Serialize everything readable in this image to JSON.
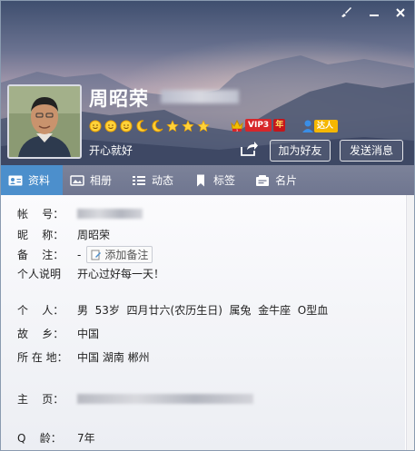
{
  "header": {
    "name": "周昭荣",
    "signature": "开心就好",
    "add_friend_label": "加为好友",
    "send_message_label": "发送消息",
    "vip_label": "VIP3",
    "vip_year": "年",
    "vip_level": "3",
    "daren_label": "达人"
  },
  "tabs": [
    {
      "label": "资料"
    },
    {
      "label": "相册"
    },
    {
      "label": "动态"
    },
    {
      "label": "标签"
    },
    {
      "label": "名片"
    }
  ],
  "profile": {
    "account_label": "帐    号：",
    "nickname_label": "昵    称：",
    "nickname_value": "周昭荣",
    "remark_label": "备    注：",
    "remark_value": "-",
    "add_remark_label": "添加备注",
    "bio_label": "个人说明",
    "bio_value": "开心过好每一天！",
    "personal_label": "个    人：",
    "personal_value": "男  53岁  四月廿六(农历生日)  属兔  金牛座  O型血",
    "hometown_label": "故    乡：",
    "hometown_value": "中国",
    "location_label": "所 在 地：",
    "location_value": "中国 湖南 郴州",
    "homepage_label": "主    页：",
    "qage_label": "Q    龄：",
    "qage_value": "7年"
  },
  "colors": {
    "tab_active": "#4c8fcc",
    "tab_bar": "#737a93",
    "vip_red": "#d7262a",
    "daren_yellow": "#f5b700"
  }
}
